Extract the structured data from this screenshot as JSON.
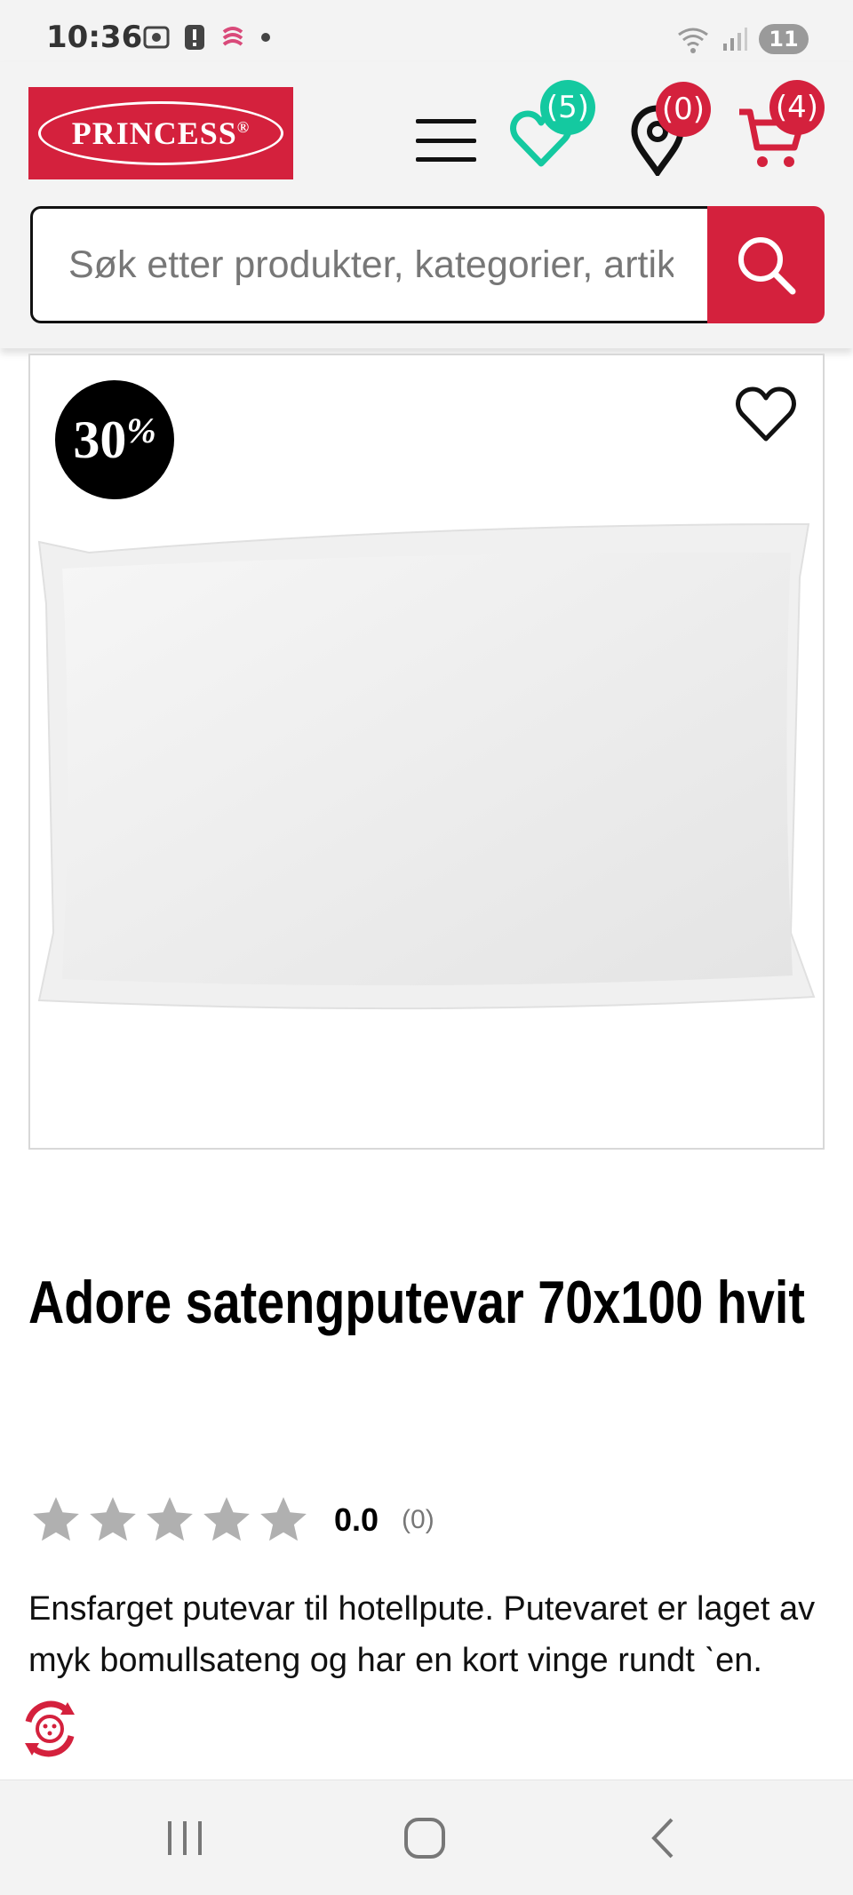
{
  "status_bar": {
    "time": "10:36",
    "battery": "11"
  },
  "header": {
    "logo_text": "PRINCESS",
    "logo_mark": "®",
    "wishlist_count": "(5)",
    "stores_count": "(0)",
    "cart_count": "(4)"
  },
  "search": {
    "placeholder": "Søk etter produkter, kategorier, artik"
  },
  "product": {
    "discount_number": "30",
    "discount_symbol": "%",
    "title": "Adore satengputevar 70x100 hvit",
    "rating_value": "0.0",
    "rating_count": "(0)",
    "rating_stars": 0,
    "description": "Ensfarget putevar til hotellpute. Putevaret er laget av myk bomullsateng og har en kort vinge rundt ˋen."
  },
  "colors": {
    "brand_red": "#d4213d",
    "wishlist_green": "#14c9a0",
    "star_gray": "#b0b0b0"
  },
  "icons": {
    "menu": "hamburger-icon",
    "wishlist": "heart-icon",
    "stores": "location-pin-icon",
    "cart": "cart-icon",
    "search": "search-icon"
  }
}
